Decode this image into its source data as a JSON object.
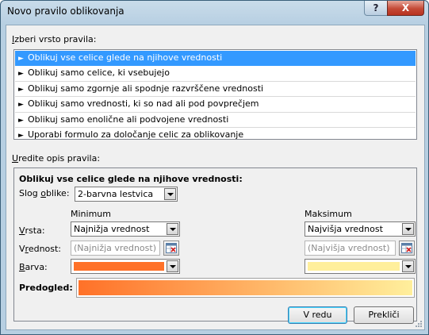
{
  "window": {
    "title": "Novo pravilo oblikovanja",
    "help_label": "?",
    "close_label": "X"
  },
  "rule_type_section": {
    "label_accel": "I",
    "label_rest": "zberi vrsto pravila:",
    "items": [
      {
        "label": "Oblikuj vse celice glede na njihove vrednosti",
        "selected": true
      },
      {
        "label": "Oblikuj samo celice, ki vsebujejo",
        "selected": false
      },
      {
        "label": "Oblikuj samo zgornje ali spodnje razvrščene vrednosti",
        "selected": false
      },
      {
        "label": "Oblikuj samo vrednosti, ki so nad ali pod povprečjem",
        "selected": false
      },
      {
        "label": "Oblikuj samo enolične ali podvojene vrednosti",
        "selected": false
      },
      {
        "label": "Uporabi formulo za določanje celic za oblikovanje",
        "selected": false
      }
    ],
    "arrow_glyph": "►"
  },
  "description_section": {
    "label_accel": "U",
    "label_rest": "redite opis pravila:",
    "heading": "Oblikuj vse celice glede na njihove vrednosti:",
    "style_label_pre": "Slog ",
    "style_label_accel": "o",
    "style_label_post": "blike:",
    "style_value": "2-barvna lestvica",
    "minimum": {
      "header": "Minimum",
      "type_value": "Najnižja vrednost",
      "value_placeholder": "(Najnižja vrednost)",
      "color": "#ff7128"
    },
    "maximum": {
      "header": "Maksimum",
      "type_value": "Najvišja vrednost",
      "value_placeholder": "(Najvišja vrednost)",
      "color": "#ffef9c"
    },
    "row_labels": {
      "type_accel": "V",
      "type_rest": "rsta:",
      "value_pre": "V",
      "value_accel": "r",
      "value_post": "ednost:",
      "color_accel": "B",
      "color_rest": "arva:"
    },
    "preview_label": "Predogled:"
  },
  "buttons": {
    "ok": "V redu",
    "cancel": "Prekliči"
  }
}
